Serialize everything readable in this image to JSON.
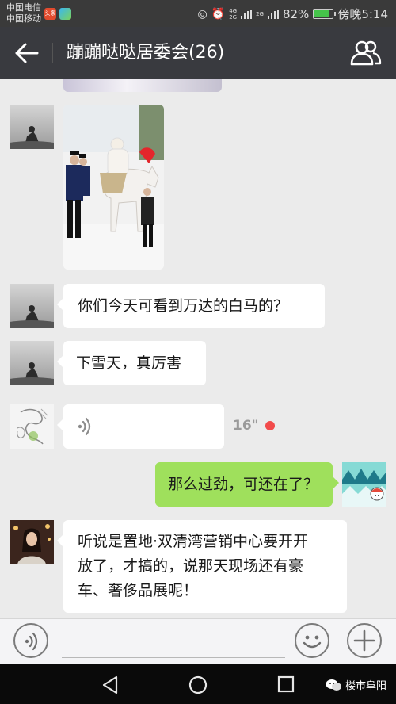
{
  "status_bar": {
    "carrier_1": "中国电信",
    "carrier_2": "中国移动",
    "app_badge": "头条",
    "network_1": "4G",
    "network_2": "2G",
    "network_3": "2G",
    "battery_percent": "82%",
    "battery_level": 0.82,
    "time": "傍晚5:14"
  },
  "header": {
    "title": "蹦蹦哒哒居委会(26)",
    "back_icon": "arrow-left-icon",
    "members_icon": "people-icon"
  },
  "messages": [
    {
      "type": "image",
      "side": "left",
      "description_icon": "photo"
    },
    {
      "type": "text",
      "side": "left",
      "text": "你们今天可看到万达的白马的？"
    },
    {
      "type": "text",
      "side": "left",
      "text": "下雪天，真厉害"
    },
    {
      "type": "voice",
      "side": "left",
      "duration": "16\"",
      "unread": true
    },
    {
      "type": "text",
      "side": "right",
      "text": "那么过劲，可还在了？"
    },
    {
      "type": "text",
      "side": "left",
      "lines": [
        "听说是置地·双清湾营销中心要开开",
        "放了，才搞的，说那天现场还有豪",
        "车、奢侈品展呢！"
      ]
    }
  ],
  "input_bar": {
    "voice_icon": "voice-mode-icon",
    "emoji_icon": "emoji-icon",
    "plus_icon": "plus-icon"
  },
  "nav_bar": {
    "watermark": "楼市阜阳"
  }
}
